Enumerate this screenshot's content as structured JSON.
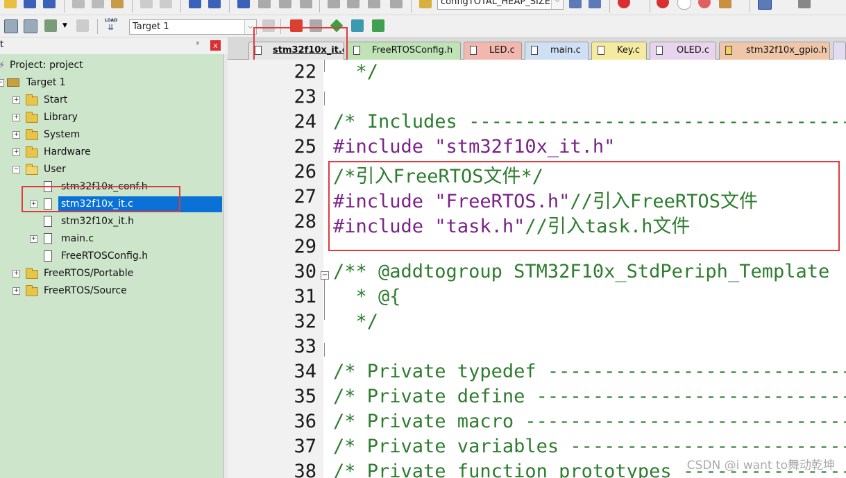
{
  "toolbar_top": {
    "define_combo": "configTOTAL_HEAP_SIZE"
  },
  "toolbar_build": {
    "target_select": "Target 1",
    "load_label": "LOAD"
  },
  "project_panel": {
    "header_title": "t",
    "pin_glyph": "ᵖ",
    "close_glyph": "x",
    "tree": [
      {
        "label": "Project: project",
        "kind": "root"
      },
      {
        "label": "Target 1",
        "kind": "target"
      },
      {
        "label": "Start",
        "kind": "folder"
      },
      {
        "label": "Library",
        "kind": "folder"
      },
      {
        "label": "System",
        "kind": "folder"
      },
      {
        "label": "Hardware",
        "kind": "folder"
      },
      {
        "label": "User",
        "kind": "folder-open"
      },
      {
        "label": "stm32f10x_conf.h",
        "kind": "file"
      },
      {
        "label": "stm32f10x_it.c",
        "kind": "file",
        "selected": true
      },
      {
        "label": "stm32f10x_it.h",
        "kind": "file"
      },
      {
        "label": "main.c",
        "kind": "file"
      },
      {
        "label": "FreeRTOSConfig.h",
        "kind": "file"
      },
      {
        "label": "FreeRTOS/Portable",
        "kind": "folder"
      },
      {
        "label": "FreeRTOS/Source",
        "kind": "folder"
      }
    ]
  },
  "tabs": [
    {
      "label": "stm32f10x_it.c",
      "active": true,
      "color": "#e6e6e6"
    },
    {
      "label": "FreeRTOSConfig.h",
      "active": false,
      "color": "#bfe3b6"
    },
    {
      "label": "LED.c",
      "active": false,
      "color": "#f2b8b0"
    },
    {
      "label": "main.c",
      "active": false,
      "color": "#cfe0f5"
    },
    {
      "label": "Key.c",
      "active": false,
      "color": "#f5eaa0"
    },
    {
      "label": "OLED.c",
      "active": false,
      "color": "#e9d4ee"
    },
    {
      "label": "stm32f10x_gpio.h",
      "active": false,
      "color": "#f0c6a8"
    }
  ],
  "editor": {
    "line_numbers": [
      "22",
      "23",
      "24",
      "25",
      "26",
      "27",
      "28",
      "29",
      "30",
      "31",
      "32",
      "33",
      "34",
      "35",
      "36",
      "37",
      "38"
    ],
    "lines": [
      {
        "text": "  */",
        "style": "cm"
      },
      {
        "text": "",
        "style": "cm"
      },
      {
        "text": "/* Includes ------------------------------------------",
        "style": "cm"
      },
      {
        "text": "#include \"stm32f10x_it.h\"",
        "style": "pp"
      },
      {
        "text": "/*引入FreeRTOS文件*/",
        "style": "cm"
      },
      {
        "text": "#include \"FreeRTOS.h\"//引入FreeRTOS文件",
        "style": "mix1"
      },
      {
        "text": "#include \"task.h\"//引入task.h文件",
        "style": "mix2"
      },
      {
        "text": "",
        "style": "cm"
      },
      {
        "text": "/** @addtogroup STM32F10x_StdPeriph_Template",
        "style": "cm"
      },
      {
        "text": "  * @{",
        "style": "cm"
      },
      {
        "text": "  */",
        "style": "cm"
      },
      {
        "text": "",
        "style": "cm"
      },
      {
        "text": "/* Private typedef -----------------------------------",
        "style": "cm"
      },
      {
        "text": "/* Private define ------------------------------------",
        "style": "cm"
      },
      {
        "text": "/* Private macro -------------------------------------",
        "style": "cm"
      },
      {
        "text": "/* Private variables ---------------------------------",
        "style": "cm"
      },
      {
        "text": "/* Private function prototypes -----------------------",
        "style": "cm"
      }
    ],
    "mix1": {
      "directive": "#include ",
      "string": "\"FreeRTOS.h\"",
      "comment": "//引入FreeRTOS文件"
    },
    "mix2": {
      "directive": "#include ",
      "string": "\"task.h\"",
      "comment": "//引入task.h文件"
    }
  },
  "watermark": "CSDN @i want to舞动乾坤"
}
